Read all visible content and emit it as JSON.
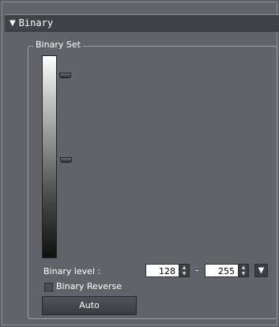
{
  "header": {
    "title": "Binary",
    "expand_icon": "triangle-down-icon"
  },
  "group": {
    "title": "Binary Set"
  },
  "gradient": {
    "top_color": "#ffffff",
    "bottom_color": "#101010"
  },
  "binary_level": {
    "label": "Binary level :",
    "min_value": "128",
    "separator": "-",
    "max_value": "255"
  },
  "binary_reverse": {
    "label": "Binary Reverse",
    "checked": false
  },
  "auto_button": {
    "label": "Auto"
  },
  "colors": {
    "panel_bg": "#606468",
    "header_bg": "#3f4246",
    "accent": "#ffffff"
  }
}
